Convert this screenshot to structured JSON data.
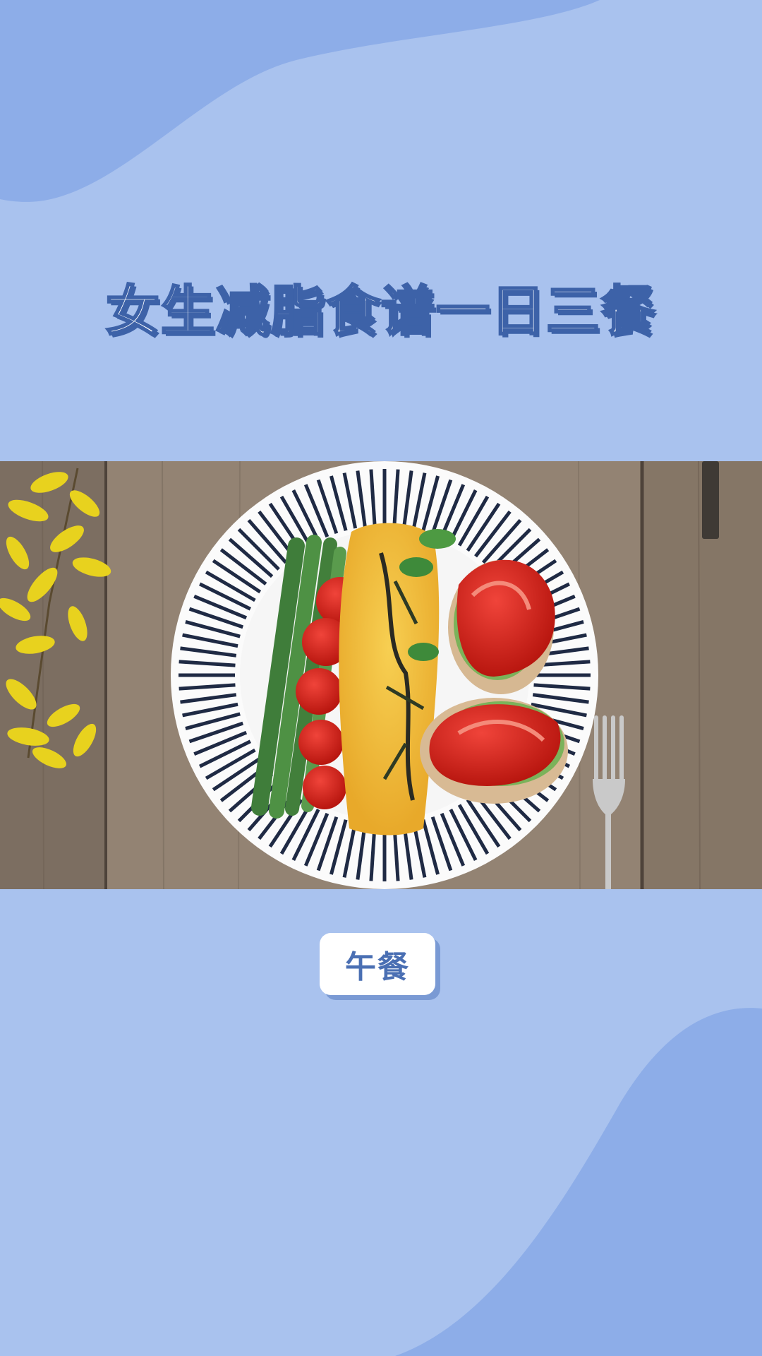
{
  "header": {
    "title": "女生减脂食谱一日三餐"
  },
  "photo": {
    "subject": "plate-with-omelette-asparagus-tomatoes"
  },
  "meal": {
    "label": "午餐"
  },
  "colors": {
    "background": "#a9c2ee",
    "wave": "#8dade8",
    "title_outline": "#3d62a8",
    "label_text": "#4a6fb3"
  }
}
